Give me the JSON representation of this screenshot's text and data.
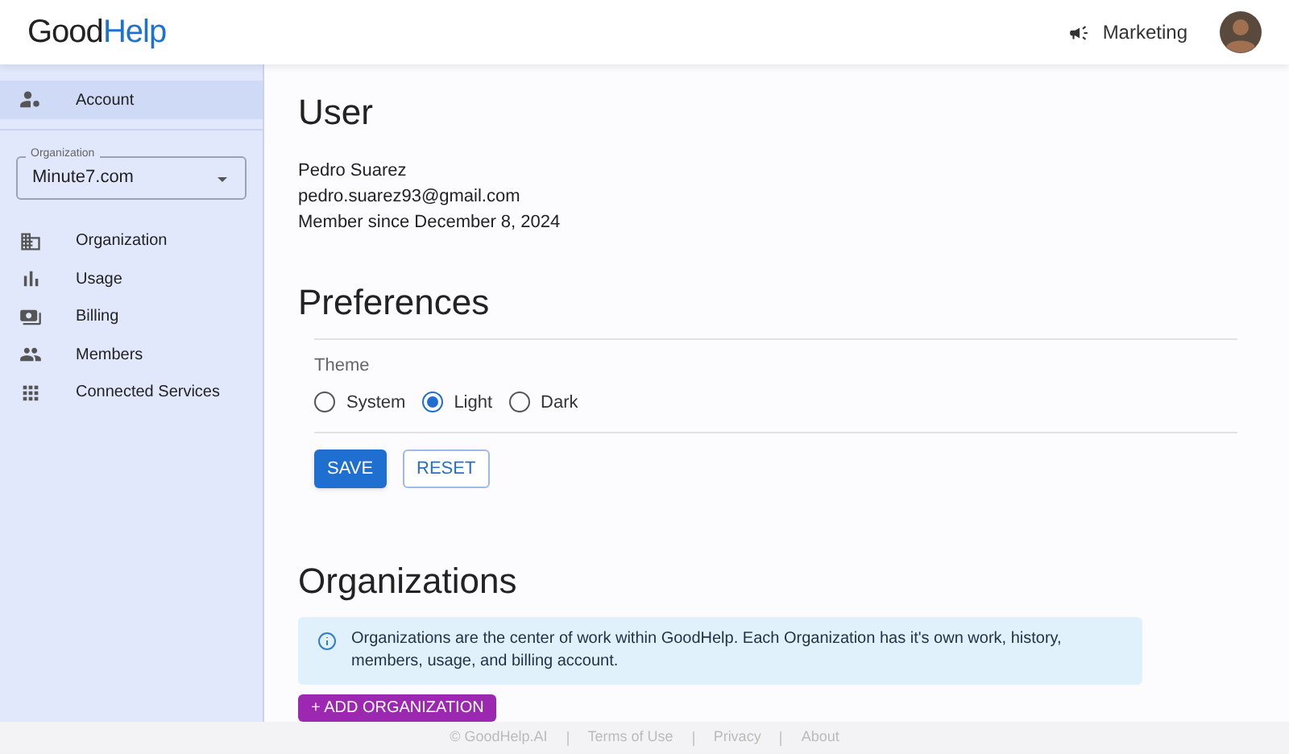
{
  "header": {
    "logo": {
      "part_1": "Good",
      "part_2": "Help"
    },
    "team": "Marketing"
  },
  "sidebar": {
    "top_item": {
      "label": "Account",
      "selected": true
    },
    "organization_select": {
      "label": "Organization",
      "value": "Minute7.com"
    },
    "items": [
      {
        "label": "Organization",
        "kind": "building",
        "selected": false
      },
      {
        "label": "Usage",
        "kind": "chart",
        "selected": false
      },
      {
        "label": "Billing",
        "kind": "billing",
        "selected": false
      },
      {
        "label": "Members",
        "kind": "people",
        "selected": false
      },
      {
        "label": "Connected Services",
        "kind": "grid",
        "selected": false
      }
    ]
  },
  "user": {
    "title": "User",
    "lines": [
      "Pedro Suarez",
      "pedro.suarez93@gmail.com",
      "Member since December 8, 2024"
    ]
  },
  "preferences": {
    "title": "Preferences",
    "theme_label": "Theme",
    "options": [
      {
        "label": "System",
        "selected": false
      },
      {
        "label": "Light",
        "selected": true
      },
      {
        "label": "Dark",
        "selected": false
      }
    ],
    "buttons": [
      {
        "label": "SAVE",
        "kind": "primary"
      },
      {
        "label": "RESET",
        "kind": "outline"
      }
    ]
  },
  "organizations": {
    "title": "Organizations",
    "info": "Organizations are the center of work within GoodHelp. Each Organization has it's own work, history, members, usage, and billing account.",
    "add_button": "+ ADD ORGANIZATION"
  },
  "footer": [
    "© GoodHelp.AI",
    "Terms of Use",
    "Privacy",
    "About"
  ]
}
